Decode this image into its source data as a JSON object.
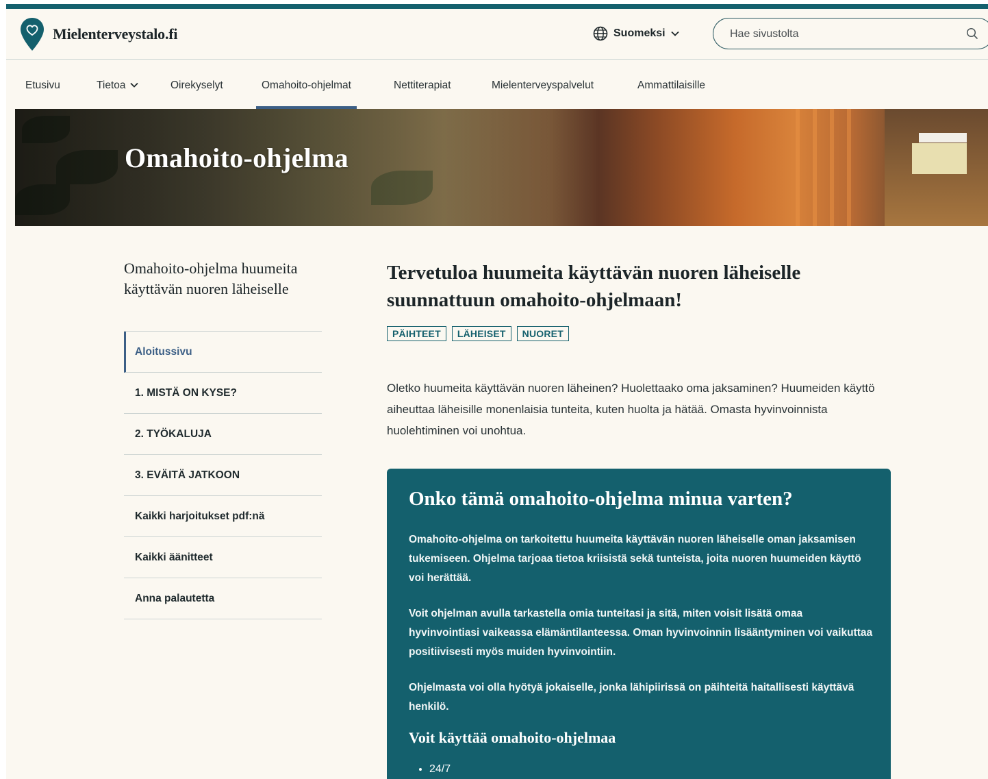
{
  "header": {
    "site_name": "Mielenterveystalo.fi",
    "language": "Suomeksi",
    "search_placeholder": "Hae sivustolta"
  },
  "nav": {
    "items": [
      {
        "label": "Etusivu"
      },
      {
        "label": "Tietoa"
      },
      {
        "label": "Oirekyselyt"
      },
      {
        "label": "Omahoito-ohjelmat"
      },
      {
        "label": "Nettiterapiat"
      },
      {
        "label": "Mielenterveyspalvelut"
      },
      {
        "label": "Ammattilaisille"
      }
    ],
    "active": "Omahoito-ohjelmat"
  },
  "hero": {
    "title": "Omahoito-ohjelma"
  },
  "sidebar": {
    "title": "Omahoito-ohjelma huumeita käyttävän nuoren läheiselle",
    "items": [
      {
        "label": "Aloitussivu"
      },
      {
        "label": "1. MISTÄ ON KYSE?"
      },
      {
        "label": "2. TYÖKALUJA"
      },
      {
        "label": "3. EVÄITÄ JATKOON"
      },
      {
        "label": "Kaikki harjoitukset pdf:nä"
      },
      {
        "label": "Kaikki äänitteet"
      },
      {
        "label": "Anna palautetta"
      }
    ],
    "active": "Aloitussivu"
  },
  "main": {
    "title": "Tervetuloa huumeita käyttävän nuoren läheiselle suunnattuun omahoito-ohjelmaan!",
    "tags": [
      "PÄIHTEET",
      "LÄHEISET",
      "NUORET"
    ],
    "intro": "Oletko huumeita käyttävän nuoren läheinen? Huolettaako oma jaksaminen? Huumeiden käyttö aiheuttaa läheisille monenlaisia tunteita, kuten huolta ja hätää. Omasta hyvinvoinnista huolehtiminen voi unohtua."
  },
  "card": {
    "title": "Onko tämä omahoito-ohjelma minua varten?",
    "paragraphs": [
      "Omahoito-ohjelma on tarkoitettu huumeita käyttävän nuoren läheiselle oman jaksamisen tukemiseen. Ohjelma tarjoaa tietoa kriisistä sekä tunteista, joita nuoren huumeiden käyttö voi herättää.",
      "Voit ohjelman avulla tarkastella omia tunteitasi ja sitä, miten voisit lisätä omaa hyvinvointiasi vaikeassa elämäntilanteessa. Oman hyvinvoinnin lisääntyminen voi vaikuttaa positiivisesti myös muiden hyvinvointiin.",
      "Ohjelmasta voi olla hyötyä jokaiselle, jonka lähipiirissä on päihteitä haitallisesti käyttävä henkilö."
    ],
    "subtitle": "Voit käyttää omahoito-ohjelmaa",
    "list": [
      "24/7"
    ]
  },
  "icons": {
    "logo": "heart-pin-icon",
    "language": "globe-icon",
    "language_caret": "chevron-down-icon",
    "search": "search-icon",
    "nav_caret": "chevron-down-icon"
  },
  "colors": {
    "brand_teal": "#14606d",
    "accent_blue": "#3c5f86",
    "page_background": "#fbf8f1"
  }
}
